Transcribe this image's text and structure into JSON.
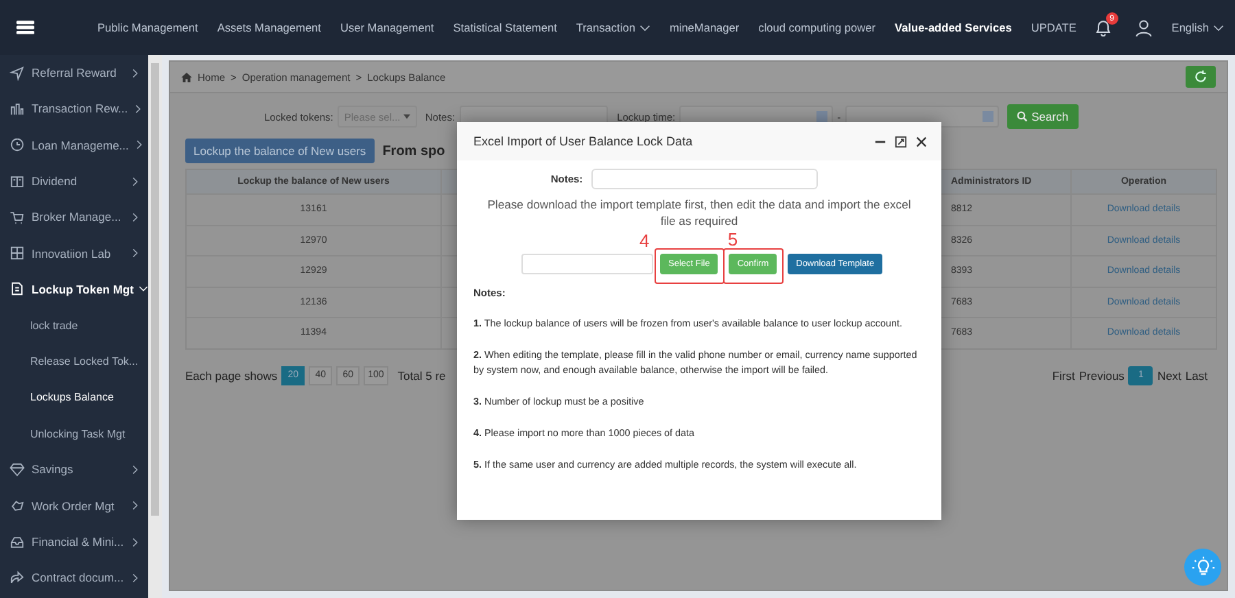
{
  "top_nav": {
    "items": [
      {
        "label": "Public Management",
        "selected": false,
        "dropdown": false
      },
      {
        "label": "Assets Management",
        "selected": false,
        "dropdown": false
      },
      {
        "label": "User Management",
        "selected": false,
        "dropdown": false
      },
      {
        "label": "Statistical Statement",
        "selected": false,
        "dropdown": false
      },
      {
        "label": "Transaction",
        "selected": false,
        "dropdown": true
      },
      {
        "label": "mineManager",
        "selected": false,
        "dropdown": false
      },
      {
        "label": "cloud computing power",
        "selected": false,
        "dropdown": false
      },
      {
        "label": "Value-added Services",
        "selected": true,
        "dropdown": false
      },
      {
        "label": "UPDATE",
        "selected": false,
        "dropdown": false
      }
    ],
    "notification_count": "9",
    "language": "English"
  },
  "sidebar": {
    "items": [
      {
        "label": "Referral Reward",
        "expanded": false
      },
      {
        "label": "Transaction Rew...",
        "expanded": false
      },
      {
        "label": "Loan Manageme...",
        "expanded": false
      },
      {
        "label": "Dividend",
        "expanded": false
      },
      {
        "label": "Broker Manage...",
        "expanded": false
      },
      {
        "label": "Innovatiion Lab",
        "expanded": false
      },
      {
        "label": "Lockup Token Mgt",
        "expanded": true,
        "children": [
          {
            "label": "lock trade",
            "selected": false
          },
          {
            "label": "Release Locked Tok...",
            "selected": false
          },
          {
            "label": "Lockups Balance",
            "selected": true
          },
          {
            "label": "Unlocking Task Mgt",
            "selected": false
          }
        ]
      },
      {
        "label": "Savings",
        "expanded": false
      },
      {
        "label": "Work Order Mgt",
        "expanded": false
      },
      {
        "label": "Financial & Mini...",
        "expanded": false
      },
      {
        "label": "Contract docum...",
        "expanded": false
      }
    ]
  },
  "breadcrumb": {
    "items": [
      "Home",
      "Operation management",
      "Lockups Balance"
    ],
    "separator": ">"
  },
  "filters": {
    "locked_tokens_label": "Locked tokens:",
    "locked_tokens_placeholder": "Please sel...",
    "notes_label": "Notes:",
    "lockup_time_label": "Lockup time:",
    "range_separator": "-",
    "search_button": "Search"
  },
  "tabs": [
    {
      "label": "Lockup the balance of New users",
      "selected": true
    },
    {
      "label": "From spo",
      "selected": false
    }
  ],
  "table": {
    "columns": [
      "Lockup the balance of New users",
      "Administrators ID",
      "Operation"
    ],
    "rows": [
      {
        "column_1": "13161",
        "administrators_id": "8812",
        "operation": "Download details"
      },
      {
        "column_1": "12970",
        "administrators_id": "8326",
        "operation": "Download details"
      },
      {
        "column_1": "12929",
        "administrators_id": "8393",
        "operation": "Download details"
      },
      {
        "column_1": "12136",
        "administrators_id": "7683",
        "operation": "Download details"
      },
      {
        "column_1": "11394",
        "administrators_id": "7683",
        "operation": "Download details"
      }
    ]
  },
  "pagination": {
    "label": "Each page shows",
    "sizes": [
      {
        "label": "20",
        "selected": true
      },
      {
        "label": "40",
        "selected": false
      },
      {
        "label": "60",
        "selected": false
      },
      {
        "label": "100",
        "selected": false
      }
    ],
    "total": "Total  5 re",
    "first": "First",
    "previous": "Previous",
    "pages": [
      {
        "label": "1",
        "selected": true
      }
    ],
    "next": "Next",
    "last": "Last"
  },
  "dialog": {
    "title": "Excel Import of User Balance Lock Data",
    "notes_label": "Notes:",
    "instruction": "Please download the import template first, then edit the data and import the excel file as required",
    "buttons": [
      {
        "label": "Select File",
        "kind": "success",
        "annotation": "4"
      },
      {
        "label": "Confirm",
        "kind": "success",
        "annotation": "5"
      },
      {
        "label": "Download Template",
        "kind": "primary"
      }
    ],
    "notes_heading": "Notes:",
    "notes": [
      "**1.** The lockup balance of users will be frozen from user's available balance to user lockup account.",
      "**2.** When editing the template, please fill in the valid phone number or email, currency name supported by system now, and enough available balance, otherwise the import will be failed.",
      "**3.** Number of lockup must be a positive",
      "**4.** Please import no more than 1000 pieces of data",
      "**5.** If the same user and currency are added multiple records, the system will execute all."
    ]
  }
}
